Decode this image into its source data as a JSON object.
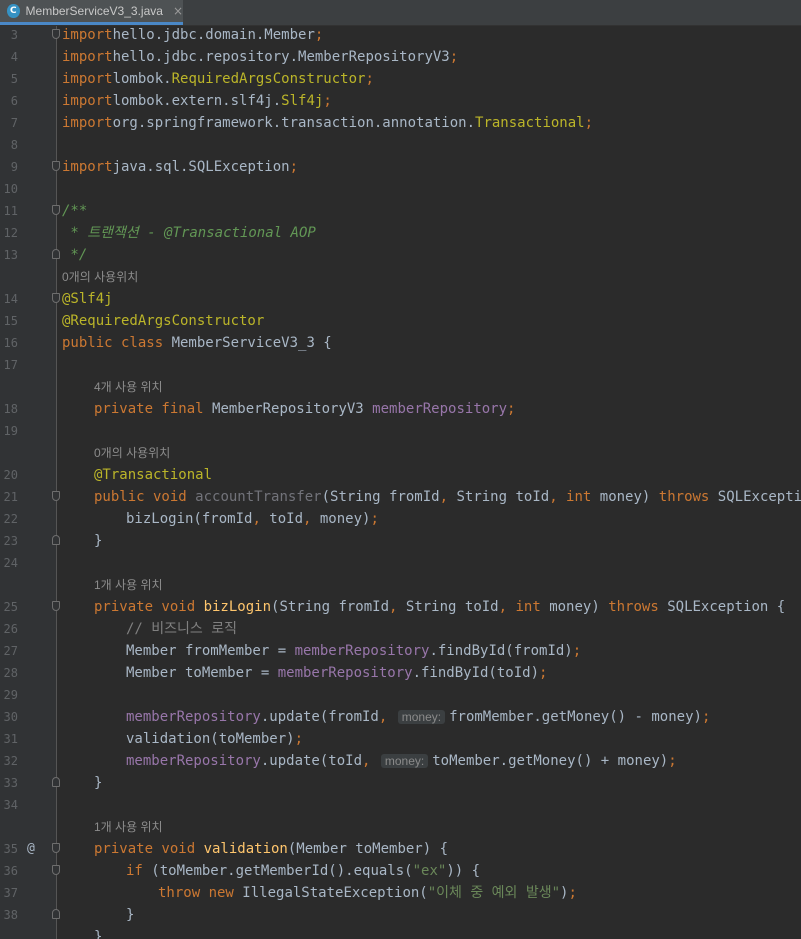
{
  "tab": {
    "icon": "C",
    "title": "MemberServiceV3_3.java",
    "close": "×"
  },
  "rows": [
    {
      "ln": "3",
      "fold": true,
      "indent": 0,
      "tokens": [
        [
          "kw",
          "import"
        ],
        [
          "",
          "hello.jdbc.domain.Member"
        ],
        [
          "kw",
          ";"
        ]
      ]
    },
    {
      "ln": "4",
      "indent": 0,
      "tokens": [
        [
          "kw",
          "import"
        ],
        [
          "",
          "hello.jdbc.repository.MemberRepositoryV3"
        ],
        [
          "kw",
          ";"
        ]
      ]
    },
    {
      "ln": "5",
      "indent": 0,
      "tokens": [
        [
          "kw",
          "import"
        ],
        [
          "",
          "lombok."
        ],
        [
          "ann",
          "RequiredArgsConstructor"
        ],
        [
          "kw",
          ";"
        ]
      ]
    },
    {
      "ln": "6",
      "indent": 0,
      "tokens": [
        [
          "kw",
          "import"
        ],
        [
          "",
          "lombok.extern.slf4j."
        ],
        [
          "ann",
          "Slf4j"
        ],
        [
          "kw",
          ";"
        ]
      ]
    },
    {
      "ln": "7",
      "indent": 0,
      "tokens": [
        [
          "kw",
          "import"
        ],
        [
          "",
          "org.springframework.transaction.annotation."
        ],
        [
          "ann",
          "Transactional"
        ],
        [
          "kw",
          ";"
        ]
      ]
    },
    {
      "ln": "8",
      "indent": 0,
      "tokens": []
    },
    {
      "ln": "9",
      "fold": true,
      "indent": 0,
      "tokens": [
        [
          "kw",
          "import"
        ],
        [
          "",
          "java.sql.SQLException"
        ],
        [
          "kw",
          ";"
        ]
      ]
    },
    {
      "ln": "10",
      "indent": 0,
      "tokens": []
    },
    {
      "ln": "11",
      "fold": true,
      "indent": 0,
      "tokens": [
        [
          "doc",
          "/**"
        ]
      ]
    },
    {
      "ln": "12",
      "indent": 0,
      "tokens": [
        [
          "doc",
          " * 트랜잭션 - @Transactional AOP"
        ]
      ]
    },
    {
      "ln": "13",
      "fold": true,
      "foldUp": true,
      "indent": 0,
      "tokens": [
        [
          "doc",
          " */"
        ]
      ]
    },
    {
      "hint": "0개의 사용위치",
      "indent": 0
    },
    {
      "ln": "14",
      "fold": true,
      "indent": 0,
      "tokens": [
        [
          "ann",
          "@Slf4j"
        ]
      ]
    },
    {
      "ln": "15",
      "indent": 0,
      "tokens": [
        [
          "ann",
          "@RequiredArgsConstructor"
        ]
      ]
    },
    {
      "ln": "16",
      "indent": 0,
      "tokens": [
        [
          "kw",
          "public class "
        ],
        [
          "",
          "MemberServiceV3_3 {"
        ]
      ]
    },
    {
      "ln": "17",
      "indent": 0,
      "tokens": []
    },
    {
      "hint": "4개 사용 위치",
      "indent": 1
    },
    {
      "ln": "18",
      "indent": 1,
      "tokens": [
        [
          "kw",
          "private final "
        ],
        [
          "",
          "MemberRepositoryV3 "
        ],
        [
          "fld",
          "memberRepository"
        ],
        [
          "kw",
          ";"
        ]
      ]
    },
    {
      "ln": "19",
      "indent": 0,
      "tokens": []
    },
    {
      "hint": "0개의 사용위치",
      "indent": 1
    },
    {
      "ln": "20",
      "indent": 1,
      "tokens": [
        [
          "ann",
          "@Transactional"
        ]
      ]
    },
    {
      "ln": "21",
      "fold": true,
      "indent": 1,
      "tokens": [
        [
          "kw",
          "public void "
        ],
        [
          "unused",
          "accountTransfer"
        ],
        [
          "",
          "(String fromId"
        ],
        [
          "kw",
          ", "
        ],
        [
          "",
          "String toId"
        ],
        [
          "kw",
          ", int "
        ],
        [
          "",
          "money) "
        ],
        [
          "kw",
          "throws "
        ],
        [
          "",
          "SQLException {"
        ]
      ]
    },
    {
      "ln": "22",
      "indent": 2,
      "tokens": [
        [
          "",
          "bizLogin(fromId"
        ],
        [
          "kw",
          ", "
        ],
        [
          "",
          "toId"
        ],
        [
          "kw",
          ", "
        ],
        [
          "",
          "money)"
        ],
        [
          "kw",
          ";"
        ]
      ]
    },
    {
      "ln": "23",
      "fold": true,
      "foldUp": true,
      "indent": 1,
      "tokens": [
        [
          "",
          "}"
        ]
      ]
    },
    {
      "ln": "24",
      "indent": 0,
      "tokens": []
    },
    {
      "hint": "1개 사용 위치",
      "indent": 1
    },
    {
      "ln": "25",
      "fold": true,
      "indent": 1,
      "tokens": [
        [
          "kw",
          "private void "
        ],
        [
          "fn",
          "bizLogin"
        ],
        [
          "",
          "(String fromId"
        ],
        [
          "kw",
          ", "
        ],
        [
          "",
          "String toId"
        ],
        [
          "kw",
          ", int "
        ],
        [
          "",
          "money) "
        ],
        [
          "kw",
          "throws "
        ],
        [
          "",
          "SQLException {"
        ]
      ]
    },
    {
      "ln": "26",
      "indent": 2,
      "tokens": [
        [
          "cmt",
          "// 비즈니스 로직"
        ]
      ]
    },
    {
      "ln": "27",
      "indent": 2,
      "tokens": [
        [
          "",
          "Member fromMember = "
        ],
        [
          "fld",
          "memberRepository"
        ],
        [
          "",
          ".findById(fromId)"
        ],
        [
          "kw",
          ";"
        ]
      ]
    },
    {
      "ln": "28",
      "indent": 2,
      "tokens": [
        [
          "",
          "Member toMember = "
        ],
        [
          "fld",
          "memberRepository"
        ],
        [
          "",
          ".findById(toId)"
        ],
        [
          "kw",
          ";"
        ]
      ]
    },
    {
      "ln": "29",
      "indent": 0,
      "tokens": []
    },
    {
      "ln": "30",
      "indent": 2,
      "tokens": [
        [
          "fld",
          "memberRepository"
        ],
        [
          "",
          ".update(fromId"
        ],
        [
          "kw",
          ", "
        ],
        [
          "inlay",
          "money:"
        ],
        [
          "",
          "fromMember.getMoney() - money)"
        ],
        [
          "kw",
          ";"
        ]
      ]
    },
    {
      "ln": "31",
      "indent": 2,
      "tokens": [
        [
          "",
          "validation(toMember)"
        ],
        [
          "kw",
          ";"
        ]
      ]
    },
    {
      "ln": "32",
      "indent": 2,
      "tokens": [
        [
          "fld",
          "memberRepository"
        ],
        [
          "",
          ".update(toId"
        ],
        [
          "kw",
          ", "
        ],
        [
          "inlay",
          "money:"
        ],
        [
          "",
          "toMember.getMoney() + money)"
        ],
        [
          "kw",
          ";"
        ]
      ]
    },
    {
      "ln": "33",
      "fold": true,
      "foldUp": true,
      "indent": 1,
      "tokens": [
        [
          "",
          "}"
        ]
      ]
    },
    {
      "ln": "34",
      "indent": 0,
      "tokens": []
    },
    {
      "hint": "1개 사용 위치",
      "indent": 1
    },
    {
      "ln": "35",
      "at": "@",
      "fold": true,
      "indent": 1,
      "tokens": [
        [
          "kw",
          "private void "
        ],
        [
          "fn",
          "validation"
        ],
        [
          "",
          "(Member toMember) {"
        ]
      ]
    },
    {
      "ln": "36",
      "fold": true,
      "indent": 2,
      "tokens": [
        [
          "kw",
          "if "
        ],
        [
          "",
          "(toMember.getMemberId().equals("
        ],
        [
          "str",
          "\"ex\""
        ],
        [
          "",
          ")) {"
        ]
      ]
    },
    {
      "ln": "37",
      "indent": 3,
      "tokens": [
        [
          "kw",
          "throw new "
        ],
        [
          "",
          "IllegalStateException("
        ],
        [
          "str",
          "\"이체 중 예외 발생\""
        ],
        [
          "",
          ")"
        ],
        [
          "kw",
          ";"
        ]
      ]
    },
    {
      "ln": "38",
      "fold": true,
      "foldUp": true,
      "indent": 2,
      "tokens": [
        [
          "",
          "}"
        ]
      ]
    },
    {
      "ln": "",
      "indent": 1,
      "tokens": [
        [
          "",
          "}"
        ]
      ]
    }
  ]
}
